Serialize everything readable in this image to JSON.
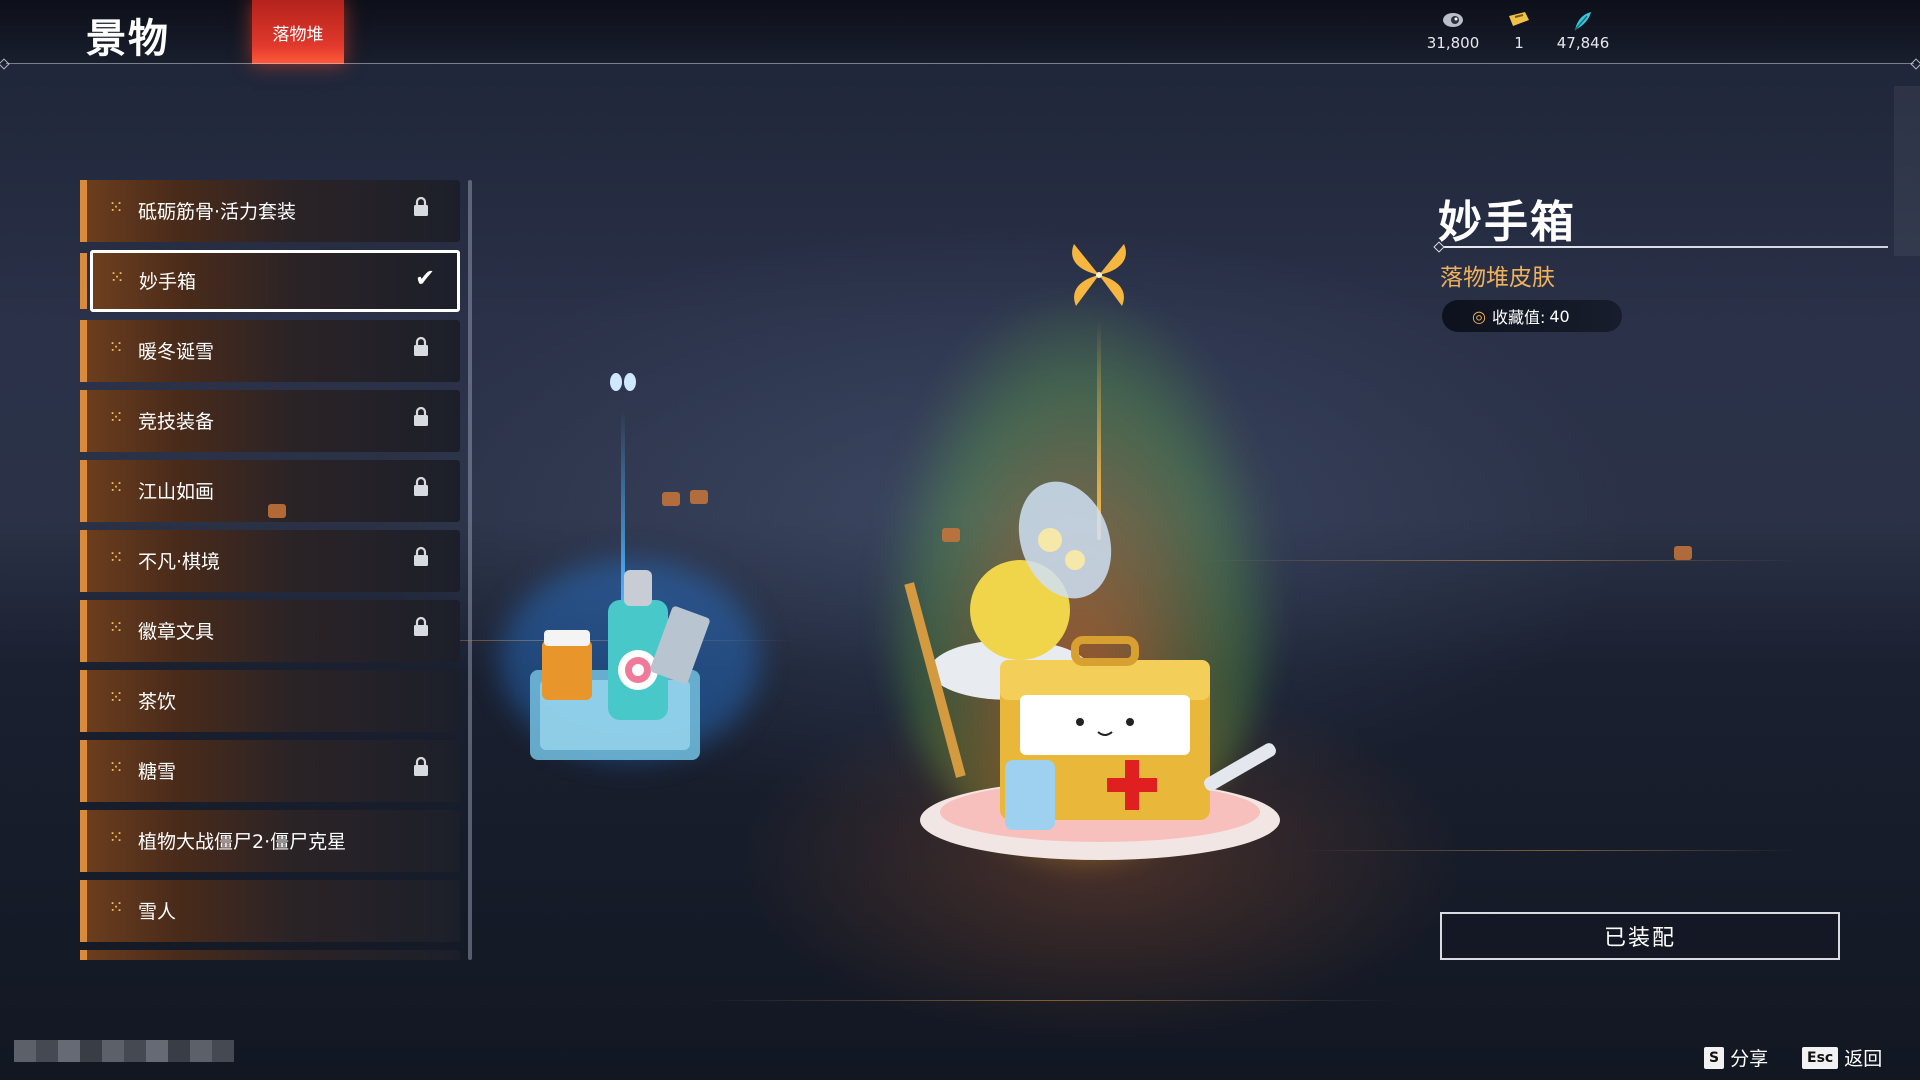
{
  "header": {
    "title": "景物",
    "active_tab": "落物堆",
    "currencies": [
      {
        "icon": "eye-coin-icon",
        "value": "31,800"
      },
      {
        "icon": "ticket-icon",
        "value": "1"
      },
      {
        "icon": "feather-icon",
        "value": "47,846"
      }
    ]
  },
  "skin_list": {
    "items": [
      {
        "label": "砥砺筋骨·活力套装",
        "state": "locked"
      },
      {
        "label": "妙手箱",
        "state": "equipped"
      },
      {
        "label": "暖冬诞雪",
        "state": "locked"
      },
      {
        "label": "竞技装备",
        "state": "locked"
      },
      {
        "label": "江山如画",
        "state": "locked"
      },
      {
        "label": "不凡·棋境",
        "state": "locked"
      },
      {
        "label": "徽章文具",
        "state": "locked"
      },
      {
        "label": "茶饮",
        "state": "owned"
      },
      {
        "label": "糖雪",
        "state": "locked"
      },
      {
        "label": "植物大战僵尸2·僵尸克星",
        "state": "owned"
      },
      {
        "label": "雪人",
        "state": "owned"
      }
    ]
  },
  "detail": {
    "title": "妙手箱",
    "subtitle": "落物堆皮肤",
    "collect_label": "收藏值:",
    "collect_value": "40",
    "equip_button": "已装配"
  },
  "hints": {
    "share_key": "S",
    "share_label": "分享",
    "back_key": "Esc",
    "back_label": "返回"
  },
  "colors": {
    "accent_red": "#e0382c",
    "accent_orange": "#f0b25a",
    "item_stripe": "#d98a3a"
  }
}
